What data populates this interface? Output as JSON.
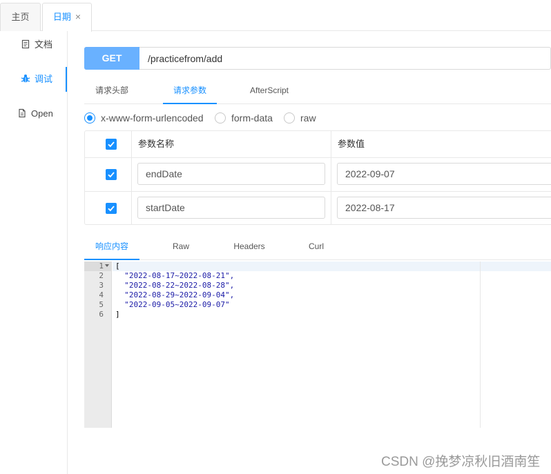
{
  "tabs": [
    {
      "label": "主页",
      "active": false
    },
    {
      "label": "日期",
      "active": true,
      "close": "×"
    }
  ],
  "sidebar": {
    "items": [
      {
        "label": "文档",
        "icon": "document-icon"
      },
      {
        "label": "调试",
        "icon": "bug-icon",
        "active": true
      },
      {
        "label": "Open",
        "icon": "file-icon"
      }
    ]
  },
  "request": {
    "method": "GET",
    "url": "/practicefrom/add"
  },
  "request_tabs": [
    "请求头部",
    "请求参数",
    "AfterScript"
  ],
  "request_tabs_active": 1,
  "body_types": [
    {
      "label": "x-www-form-urlencoded",
      "checked": true
    },
    {
      "label": "form-data",
      "checked": false
    },
    {
      "label": "raw",
      "checked": false
    }
  ],
  "params": {
    "headers": {
      "name": "参数名称",
      "value": "参数值"
    },
    "rows": [
      {
        "checked": true,
        "name": "endDate",
        "value": "2022-09-07"
      },
      {
        "checked": true,
        "name": "startDate",
        "value": "2022-08-17"
      }
    ]
  },
  "response_tabs": [
    "响应内容",
    "Raw",
    "Headers",
    "Curl"
  ],
  "response_tabs_active": 0,
  "response": {
    "line_numbers": [
      "1",
      "2",
      "3",
      "4",
      "5",
      "6"
    ],
    "lines": [
      {
        "text": "[",
        "string": false
      },
      {
        "text": "  \"2022-08-17~2022-08-21\",",
        "string": true
      },
      {
        "text": "  \"2022-08-22~2022-08-28\",",
        "string": true
      },
      {
        "text": "  \"2022-08-29~2022-09-04\",",
        "string": true
      },
      {
        "text": "  \"2022-09-05~2022-09-07\"",
        "string": true
      },
      {
        "text": "]",
        "string": false
      }
    ]
  },
  "watermark": "CSDN @挽梦凉秋旧酒南笙",
  "colors": {
    "accent": "#1890ff",
    "method_bg": "#69b1ff",
    "string": "#1a1aa6"
  }
}
